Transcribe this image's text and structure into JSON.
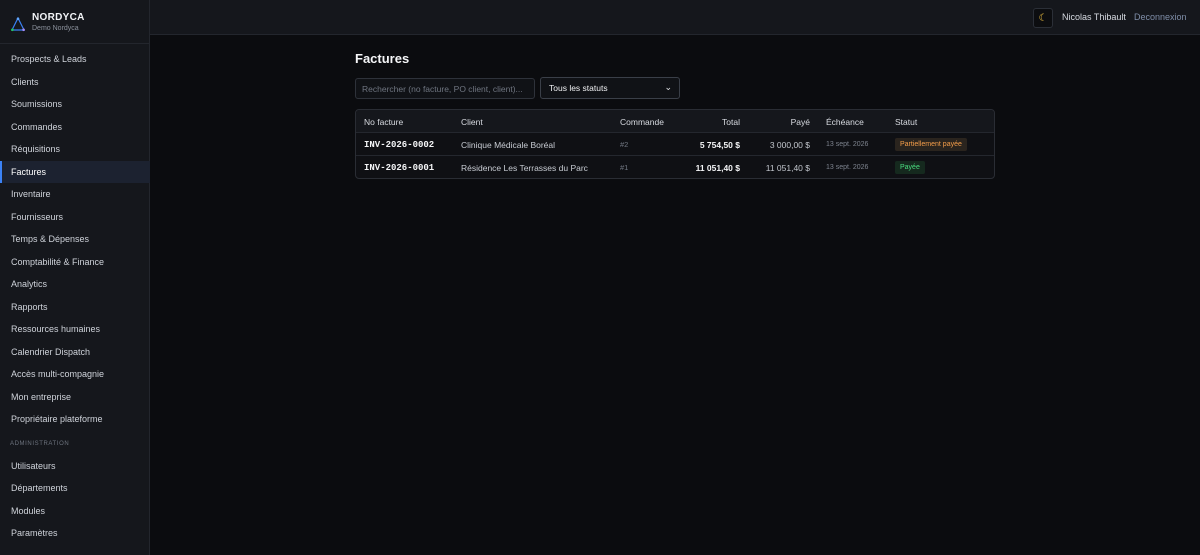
{
  "brand": {
    "name": "NORDYCA",
    "subtitle": "Demo Nordyca"
  },
  "sidebar": {
    "items": [
      {
        "label": "Prospects & Leads",
        "active": false
      },
      {
        "label": "Clients",
        "active": false
      },
      {
        "label": "Soumissions",
        "active": false
      },
      {
        "label": "Commandes",
        "active": false
      },
      {
        "label": "Réquisitions",
        "active": false
      },
      {
        "label": "Factures",
        "active": true
      },
      {
        "label": "Inventaire",
        "active": false
      },
      {
        "label": "Fournisseurs",
        "active": false
      },
      {
        "label": "Temps & Dépenses",
        "active": false
      },
      {
        "label": "Comptabilité & Finance",
        "active": false
      },
      {
        "label": "Analytics",
        "active": false
      },
      {
        "label": "Rapports",
        "active": false
      },
      {
        "label": "Ressources humaines",
        "active": false
      },
      {
        "label": "Calendrier Dispatch",
        "active": false
      },
      {
        "label": "Accès multi-compagnie",
        "active": false
      },
      {
        "label": "Mon entreprise",
        "active": false
      },
      {
        "label": "Propriétaire plateforme",
        "active": false
      }
    ],
    "admin_section": "ADMINISTRATION",
    "admin_items": [
      {
        "label": "Utilisateurs"
      },
      {
        "label": "Départements"
      },
      {
        "label": "Modules"
      },
      {
        "label": "Paramètres"
      }
    ]
  },
  "topbar": {
    "theme_icon": "moon-icon",
    "user_name": "Nicolas Thibault",
    "logout_label": "Deconnexion"
  },
  "main": {
    "title": "Factures",
    "search_placeholder": "Rechercher (no facture, PO client, client)...",
    "status_filter": "Tous les statuts",
    "columns": [
      "No facture",
      "Client",
      "Commande",
      "Total",
      "Payé",
      "Échéance",
      "Statut"
    ],
    "rows": [
      {
        "number": "INV-2026-0002",
        "client": "Clinique Médicale Boréal",
        "order": "#2",
        "total": "5 754,50 $",
        "paid": "3 000,00 $",
        "due": "13 sept. 2026",
        "status": "Partiellement payée",
        "status_color": "#f59e4a"
      },
      {
        "number": "INV-2026-0001",
        "client": "Résidence Les Terrasses du Parc",
        "order": "#1",
        "total": "11 051,40 $",
        "paid": "11 051,40 $",
        "due": "13 sept. 2026",
        "status": "Payée",
        "status_color": "#4ade80"
      }
    ]
  },
  "colors": {
    "accent": "#3b82f6",
    "background": "#0b0c0f",
    "sidebar": "#15171c"
  }
}
